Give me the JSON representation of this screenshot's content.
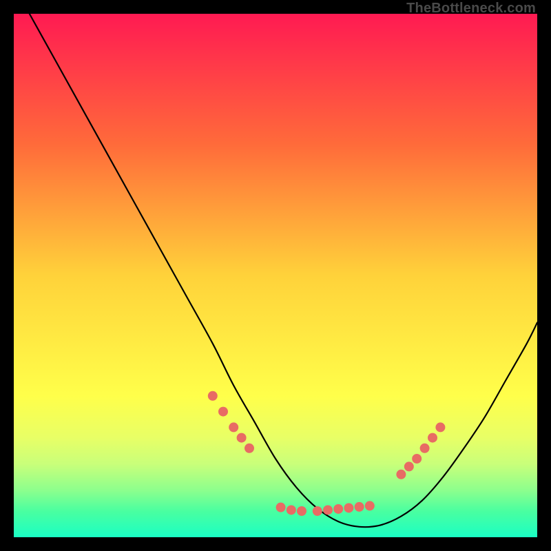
{
  "watermark": "TheBottleneck.com",
  "chart_data": {
    "type": "line",
    "title": "",
    "xlabel": "",
    "ylabel": "",
    "xlim": [
      0,
      100
    ],
    "ylim": [
      0,
      100
    ],
    "background_gradient": {
      "stops": [
        {
          "offset": 0,
          "color": "#ff1a52"
        },
        {
          "offset": 25,
          "color": "#ff6b3a"
        },
        {
          "offset": 50,
          "color": "#ffd23a"
        },
        {
          "offset": 73,
          "color": "#ffff4a"
        },
        {
          "offset": 81,
          "color": "#e8ff66"
        },
        {
          "offset": 86,
          "color": "#c9ff7a"
        },
        {
          "offset": 91,
          "color": "#8dff8d"
        },
        {
          "offset": 95,
          "color": "#4affa0"
        },
        {
          "offset": 100,
          "color": "#1affc4"
        }
      ]
    },
    "series": [
      {
        "name": "curve",
        "color": "#000000",
        "x": [
          3,
          8,
          13,
          18,
          23,
          28,
          33,
          38,
          42,
          46,
          50,
          54,
          58,
          62,
          66,
          70,
          74,
          78,
          82,
          86,
          90,
          94,
          98,
          100
        ],
        "y": [
          100,
          91,
          82,
          73,
          64,
          55,
          46,
          37,
          29,
          22,
          15,
          9.5,
          5.5,
          3,
          2,
          2.3,
          4,
          7,
          11.5,
          17,
          23,
          30,
          37,
          41
        ]
      }
    ],
    "markers": {
      "color": "#e86b64",
      "radius": 7,
      "groups": [
        {
          "x": [
            38,
            40,
            42,
            43.5,
            45
          ],
          "y": [
            27,
            24,
            21,
            19,
            17
          ]
        },
        {
          "x": [
            51,
            53,
            55,
            58,
            60,
            62,
            64,
            66,
            68
          ],
          "y": [
            5.7,
            5.2,
            5,
            5,
            5.2,
            5.4,
            5.6,
            5.8,
            6
          ]
        },
        {
          "x": [
            74,
            75.5,
            77,
            78.5,
            80,
            81.5
          ],
          "y": [
            12,
            13.5,
            15,
            17,
            19,
            21
          ]
        }
      ]
    }
  }
}
